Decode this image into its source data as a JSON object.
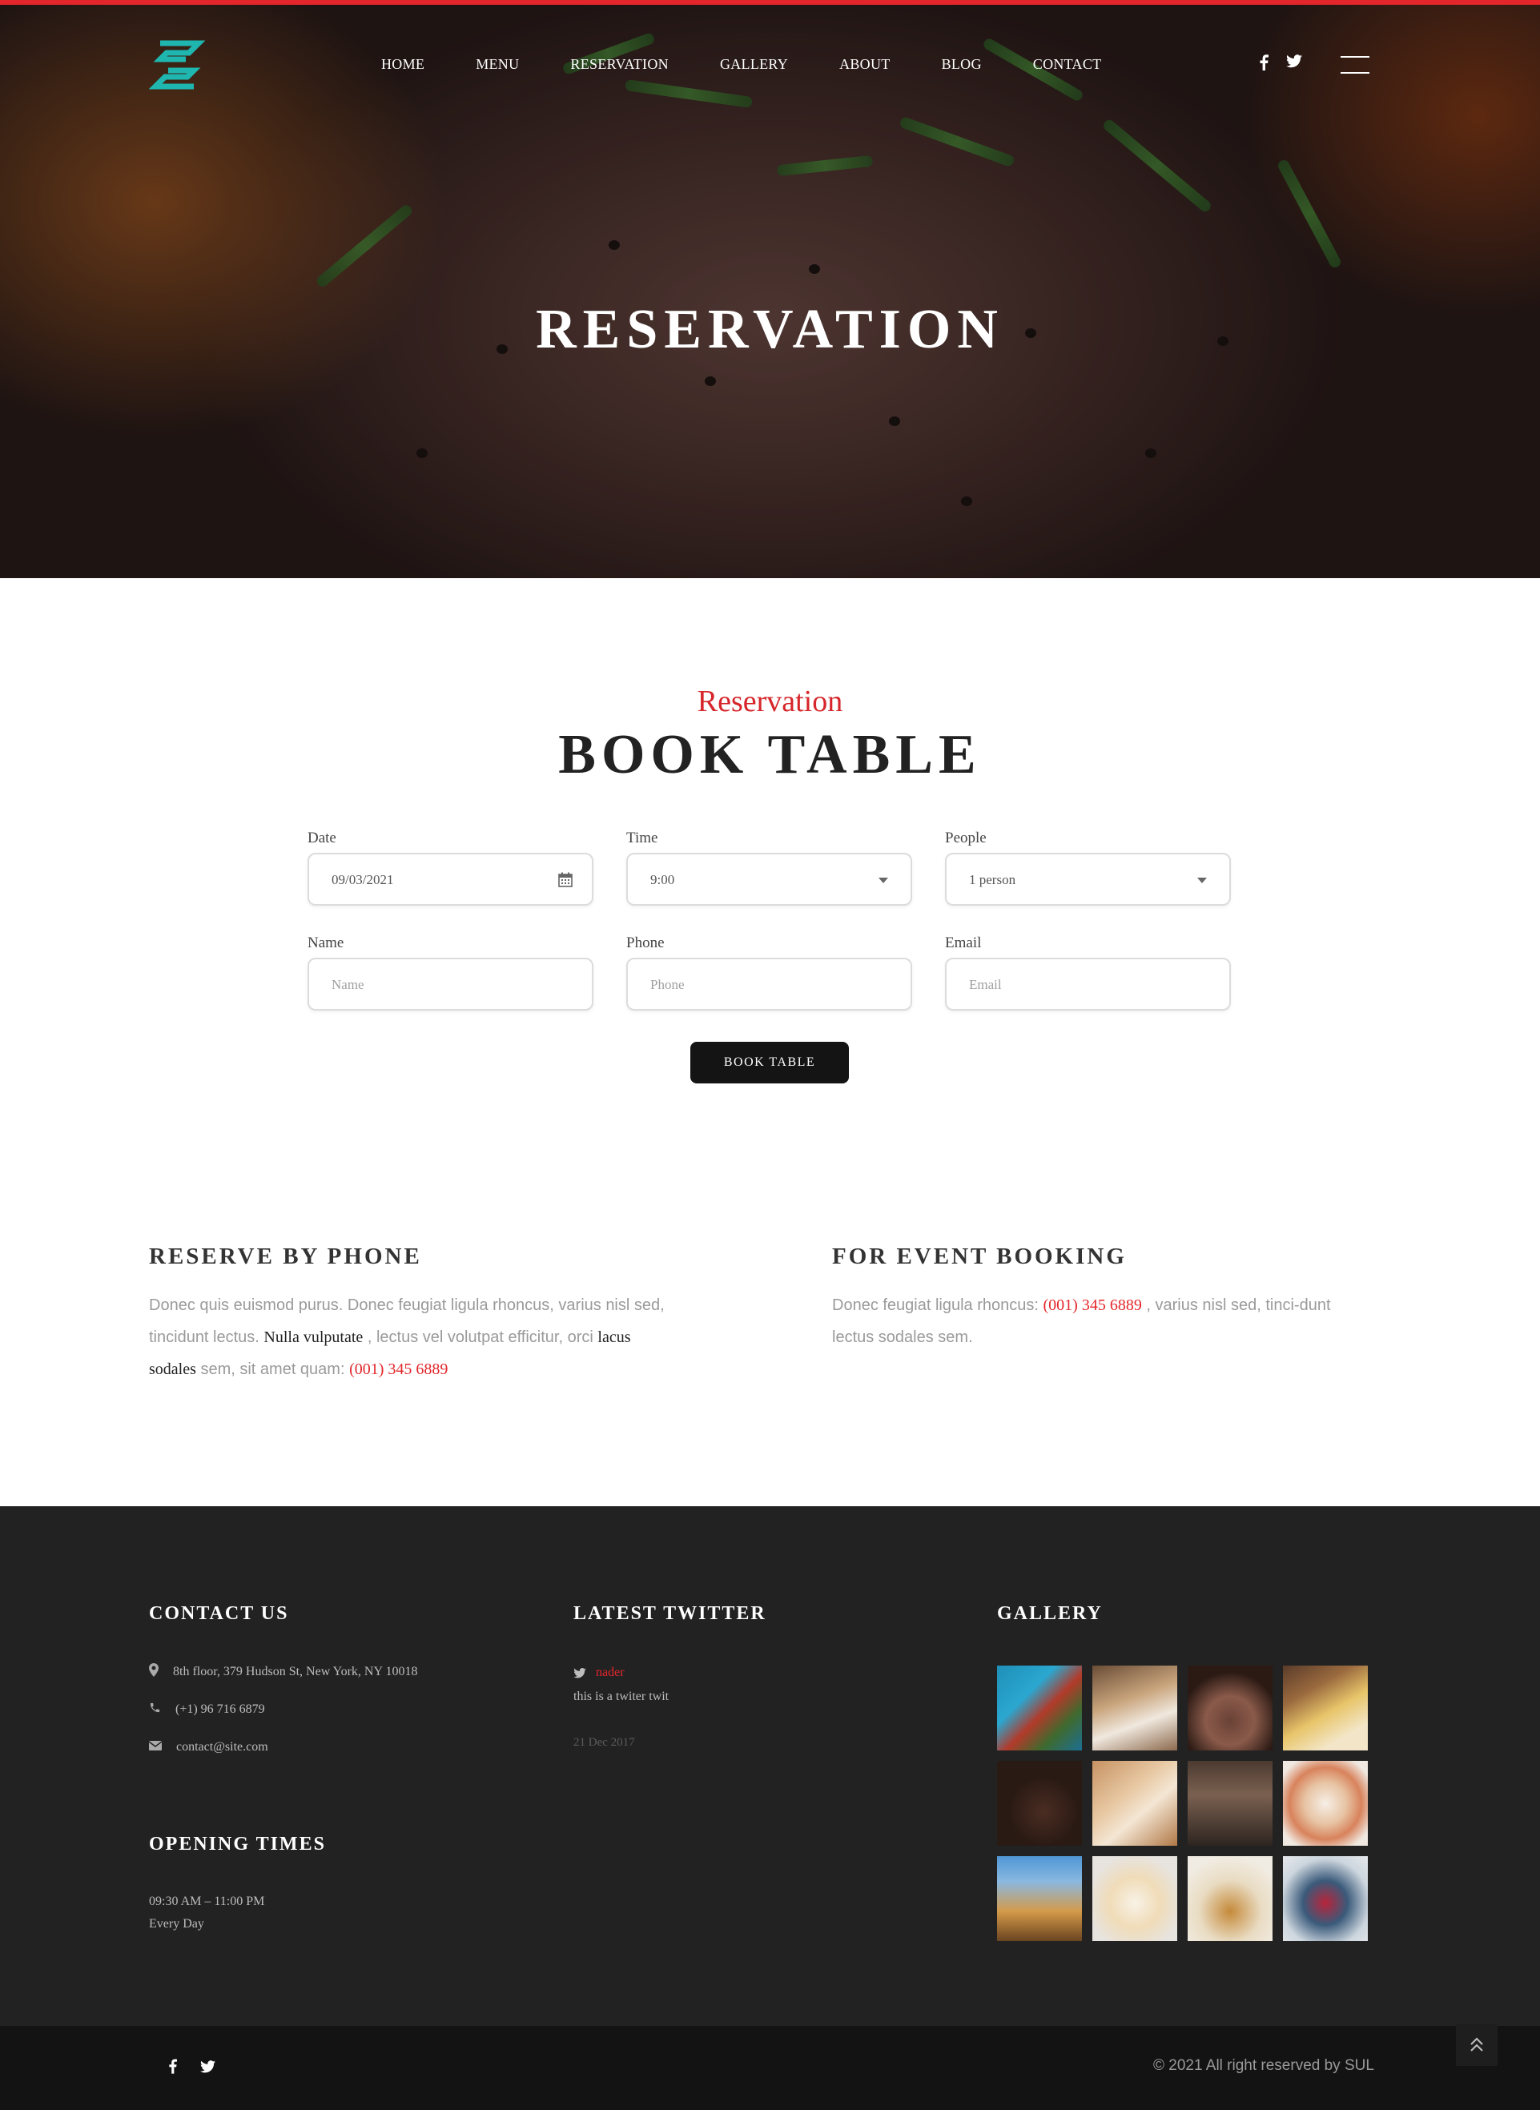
{
  "nav": {
    "items": [
      "HOME",
      "MENU",
      "RESERVATION",
      "GALLERY",
      "ABOUT",
      "BLOG",
      "CONTACT"
    ],
    "social": [
      "facebook-icon",
      "twitter-icon"
    ],
    "menu_icon": "hamburger-icon"
  },
  "hero": {
    "title": "RESERVATION"
  },
  "booking": {
    "subtitle": "Reservation",
    "title": "BOOK TABLE",
    "date": {
      "label": "Date",
      "value": "09/03/2021"
    },
    "time": {
      "label": "Time",
      "value": "9:00"
    },
    "people": {
      "label": "People",
      "value": "1 person"
    },
    "name": {
      "label": "Name",
      "placeholder": "Name"
    },
    "phone": {
      "label": "Phone",
      "placeholder": "Phone"
    },
    "email": {
      "label": "Email",
      "placeholder": "Email"
    },
    "button": "BOOK TABLE"
  },
  "reserve_phone": {
    "title": "RESERVE BY PHONE",
    "text_1": "Donec quis euismod purus. Donec feugiat ligula rhoncus, varius nisl sed,",
    "text_2a": "tincidunt lectus.",
    "text_2b": "Nulla vulputate",
    "text_2c": ", lectus vel volutpat efficitur, orci",
    "text_2d": "lacus",
    "text_3a": "sodales",
    "text_3b": "sem, sit amet quam:",
    "text_3c": "(001) 345 6889"
  },
  "event_booking": {
    "title": "FOR EVENT BOOKING",
    "text_1a": "Donec feugiat ligula rhoncus:",
    "text_1b": "(001) 345 6889",
    "text_1c": ", varius nisl sed, tinci-dunt",
    "text_2": "lectus sodales sem."
  },
  "footer": {
    "contact": {
      "title": "CONTACT US",
      "address": "8th floor, 379 Hudson St, New York, NY 10018",
      "phone": "(+1) 96 716 6879",
      "email": "contact@site.com"
    },
    "opening": {
      "title": "OPENING TIMES",
      "hours": "09:30 AM – 11:00 PM",
      "days": "Every Day"
    },
    "twitter": {
      "title": "LATEST TWITTER",
      "user": "nader",
      "text": "this is a twiter twit",
      "date": "21 Dec 2017"
    },
    "gallery": {
      "title": "GALLERY"
    },
    "copyright": "© 2021 All right reserved by SUL"
  },
  "colors": {
    "accent": "#e3262b",
    "footer_bg": "#222223",
    "bottom_bar": "#131313",
    "logo": "#1fb6b0"
  }
}
